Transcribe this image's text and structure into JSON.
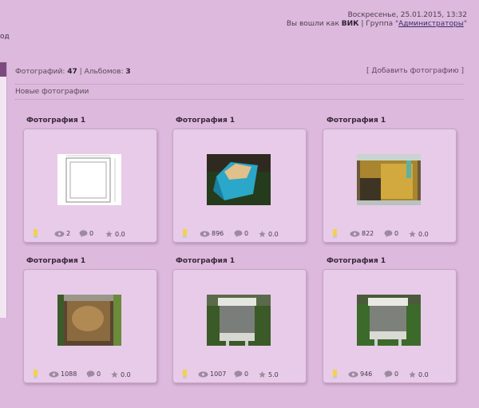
{
  "header": {
    "nav_stub": "од",
    "date": "Воскресенье, 25.01.2015, 13:32",
    "login_prefix": "Вы вошли как",
    "user": "ВИК",
    "group_prefix": "| Группа \"",
    "group": "Администраторы",
    "group_suffix": "\""
  },
  "stats": {
    "photos_label": "Фотографий:",
    "photos_count": "47",
    "sep": "|",
    "albums_label": "Альбомов:",
    "albums_count": "3"
  },
  "add_photo": {
    "open": "[",
    "label": "Добавить фотографию",
    "close": "]"
  },
  "section_title": "Новые фотографии",
  "photos": [
    {
      "title": "Фотография 1",
      "views": "2",
      "comments": "0",
      "rating": "0.0",
      "thumb": "frame-drawing"
    },
    {
      "title": "Фотография 1",
      "views": "896",
      "comments": "0",
      "rating": "0.0",
      "thumb": "blue-box"
    },
    {
      "title": "Фотография 1",
      "views": "822",
      "comments": "0",
      "rating": "0.0",
      "thumb": "honeycomb"
    },
    {
      "title": "Фотография 1",
      "views": "1088",
      "comments": "0",
      "rating": "0.0",
      "thumb": "bee-hive-brood"
    },
    {
      "title": "Фотография 1",
      "views": "1007",
      "comments": "0",
      "rating": "5.0",
      "thumb": "hive-outdoor"
    },
    {
      "title": "Фотография 1",
      "views": "946",
      "comments": "0",
      "rating": "0.0",
      "thumb": "hive-outdoor"
    }
  ]
}
